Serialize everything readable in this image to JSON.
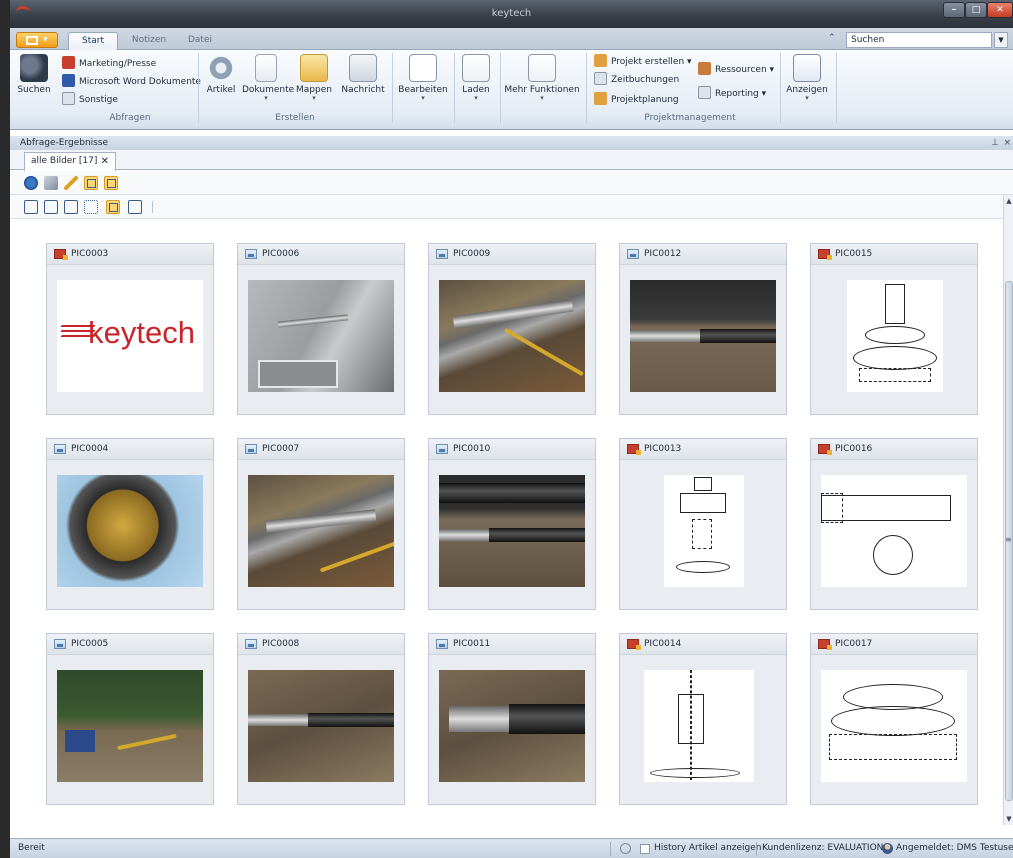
{
  "window": {
    "title": "keytech"
  },
  "ribbon_tabs": [
    {
      "label": "Start",
      "active": true
    },
    {
      "label": "Notizen",
      "active": false
    },
    {
      "label": "Datei",
      "active": false
    }
  ],
  "search": {
    "value": "Suchen"
  },
  "ribbon": {
    "abfragen": {
      "label": "Abfragen",
      "suchen": "Suchen",
      "items": [
        "Marketing/Presse",
        "Microsoft Word Dokumente",
        "Sonstige"
      ]
    },
    "erstellen": {
      "label": "Erstellen",
      "buttons": [
        "Artikel",
        "Dokumente",
        "Mappen",
        "Nachricht"
      ]
    },
    "bearbeiten": "Bearbeiten",
    "laden": "Laden",
    "mehr_funktionen": "Mehr Funktionen",
    "projektmanagement": {
      "label": "Projektmanagement",
      "items": [
        "Projekt erstellen",
        "Zeitbuchungen",
        "Projektplanung"
      ],
      "ressourcen": "Ressourcen",
      "reporting": "Reporting"
    },
    "anzeigen": "Anzeigen"
  },
  "panel": {
    "title": "Abfrage-Ergebnisse",
    "tab_label": "alle Bilder [17]"
  },
  "gallery": {
    "items": [
      {
        "name": "PIC0003",
        "type": "doc"
      },
      {
        "name": "PIC0006",
        "type": "img"
      },
      {
        "name": "PIC0009",
        "type": "img"
      },
      {
        "name": "PIC0012",
        "type": "img"
      },
      {
        "name": "PIC0015",
        "type": "doc"
      },
      {
        "name": "PIC0004",
        "type": "img"
      },
      {
        "name": "PIC0007",
        "type": "img"
      },
      {
        "name": "PIC0010",
        "type": "img"
      },
      {
        "name": "PIC0013",
        "type": "doc"
      },
      {
        "name": "PIC0016",
        "type": "doc"
      },
      {
        "name": "PIC0005",
        "type": "img"
      },
      {
        "name": "PIC0008",
        "type": "img"
      },
      {
        "name": "PIC0011",
        "type": "img"
      },
      {
        "name": "PIC0014",
        "type": "doc"
      },
      {
        "name": "PIC0017",
        "type": "doc"
      }
    ],
    "logo_text": "keytech"
  },
  "statusbar": {
    "left": "Bereit",
    "history": "History Artikel anzeigen",
    "license": "Kundenlizenz: EVALUATION",
    "user": "Angemeldet: DMS Testuser"
  }
}
